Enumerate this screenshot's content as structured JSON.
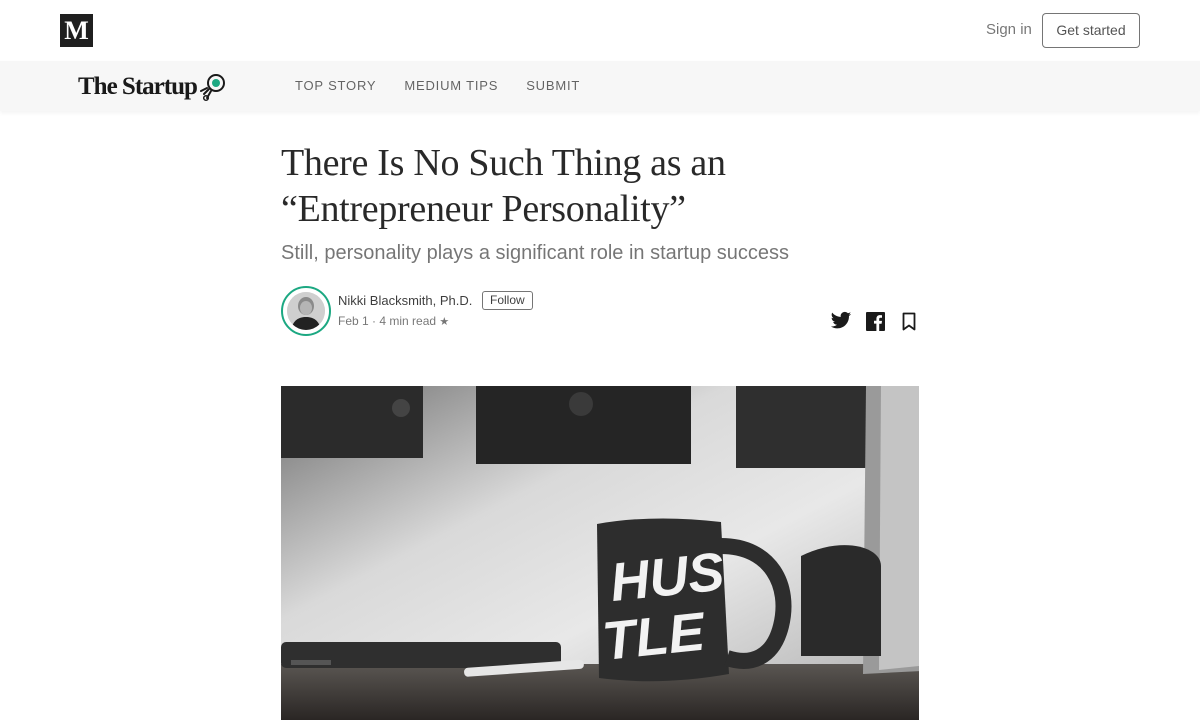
{
  "topbar": {
    "logo_letter": "M",
    "signin_label": "Sign in",
    "getstarted_label": "Get started"
  },
  "publication": {
    "name": "The Startup",
    "nav": [
      "TOP STORY",
      "MEDIUM TIPS",
      "SUBMIT"
    ]
  },
  "article": {
    "title_line1": "There Is No Such Thing as an",
    "title_line2": "“Entrepreneur Personality”",
    "subtitle": "Still, personality plays a significant role in startup success",
    "author": "Nikki Blacksmith, Ph.D.",
    "follow_label": "Follow",
    "date": "Feb 1",
    "read_time": "4 min read",
    "star": "★",
    "hero_mug_text_1": "HUS",
    "hero_mug_text_2": "TLE"
  },
  "icons": {
    "share": [
      "twitter-icon",
      "facebook-icon",
      "bookmark-icon"
    ]
  },
  "colors": {
    "accent_green": "#1ca882",
    "pubbar_bg": "#f7f7f7"
  }
}
